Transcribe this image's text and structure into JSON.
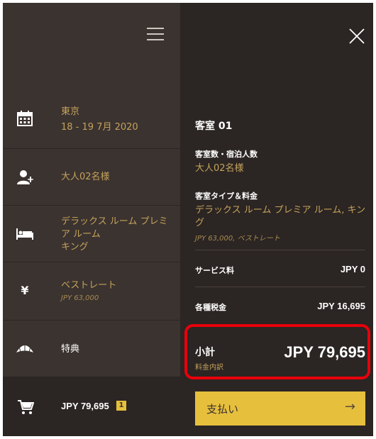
{
  "left": {
    "items": [
      {
        "icon": "calendar-icon",
        "label": "東京",
        "sub": "18 - 19 7月 2020"
      },
      {
        "icon": "add-user-icon",
        "label": "大人02名様"
      },
      {
        "icon": "bed-icon",
        "label": "デラックス ルーム プレミア ルーム",
        "sub": "キング"
      },
      {
        "icon": "yen-icon",
        "glyph": "¥",
        "label": "ベストレート",
        "sub": "JPY 63,000"
      },
      {
        "icon": "fan-icon",
        "label": "特典"
      }
    ],
    "cart": {
      "icon": "cart-icon",
      "amount": "JPY 79,695",
      "count": "1"
    }
  },
  "right": {
    "title": "客室 01",
    "rooms_guests_label": "客室数・宿泊人数",
    "rooms_guests_value": "大人02名様",
    "room_type_label": "客室タイプ＆料金",
    "room_type_value": "デラックス ルーム プレミア ルーム, キング",
    "room_rate": "JPY 63,000, ベストレート",
    "service_label": "サービス料",
    "service_value": "JPY 0",
    "tax_label": "各種税金",
    "tax_value": "JPY 16,695",
    "subtotal_label": "小計",
    "subtotal_link": "料金内訳",
    "subtotal_value": "JPY 79,695",
    "pay_label": "支払い",
    "pay_arrow": "→"
  },
  "colors": {
    "accent": "#e6bf3d",
    "gold_text": "#c4a25b",
    "highlight": "#e8000b",
    "panel_left": "#3b3330",
    "panel_right": "#2b2523"
  }
}
